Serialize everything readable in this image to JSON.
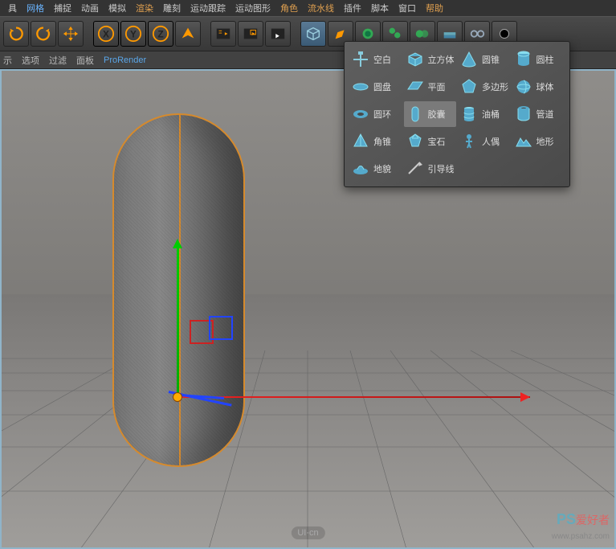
{
  "menu": [
    "具",
    "网格",
    "捕捉",
    "动画",
    "模拟",
    "渲染",
    "雕刻",
    "运动跟踪",
    "运动图形",
    "角色",
    "流水线",
    "插件",
    "脚本",
    "窗口",
    "帮助"
  ],
  "menu_active": 1,
  "submenu": {
    "items": [
      "示",
      "选项",
      "过滤",
      "面板",
      "ProRender"
    ],
    "active": 4
  },
  "popup": {
    "items": [
      [
        "空白",
        "立方体",
        "圆锥",
        "圆柱"
      ],
      [
        "圆盘",
        "平面",
        "多边形",
        "球体"
      ],
      [
        "圆环",
        "胶囊",
        "油桶",
        "管道"
      ],
      [
        "角锥",
        "宝石",
        "人偶",
        "地形"
      ],
      [
        "地貌",
        "引导线",
        "",
        ""
      ]
    ],
    "selected": "胶囊"
  },
  "watermark": "UI·cn",
  "watermark2": {
    "a": "PS",
    "b": "爱好者",
    "c": "www.psahz.com"
  }
}
